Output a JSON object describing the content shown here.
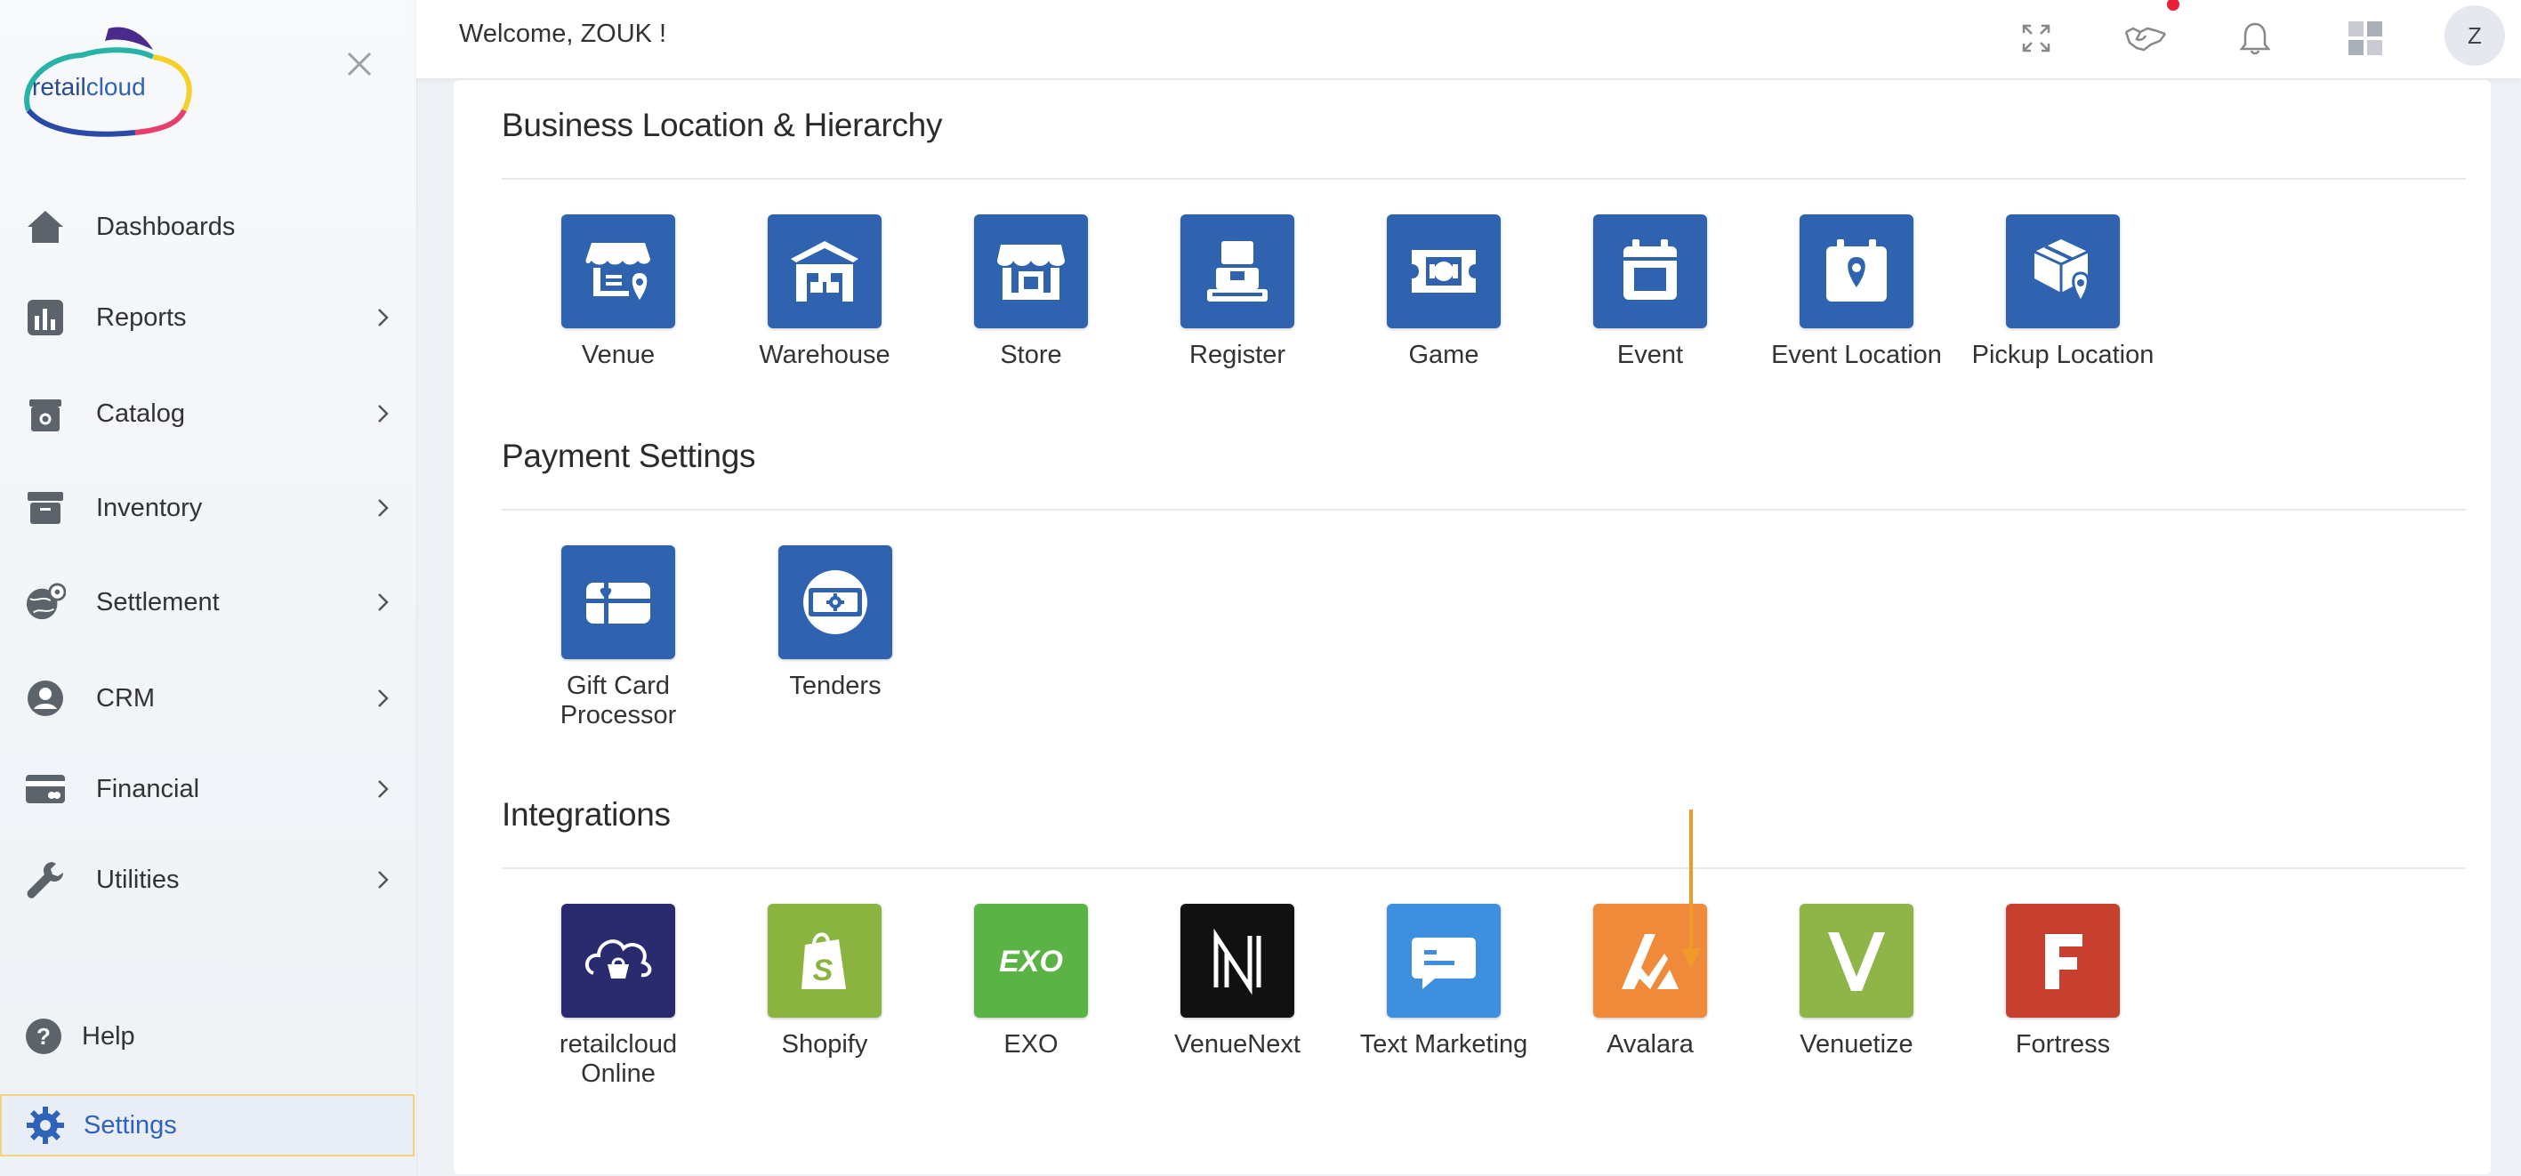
{
  "logo": {
    "text_a": "retail",
    "text_b": "cloud"
  },
  "sidebar": {
    "items": [
      {
        "label": "Dashboards",
        "icon": "home-icon"
      },
      {
        "label": "Reports",
        "icon": "bar-chart-icon"
      },
      {
        "label": "Catalog",
        "icon": "catalog-bag-icon"
      },
      {
        "label": "Inventory",
        "icon": "archive-box-icon"
      },
      {
        "label": "Settlement",
        "icon": "globe-location-icon"
      },
      {
        "label": "CRM",
        "icon": "user-circle-icon"
      },
      {
        "label": "Financial",
        "icon": "credit-card-icon"
      },
      {
        "label": "Utilities",
        "icon": "wrench-icon"
      }
    ],
    "help_label": "Help",
    "settings_label": "Settings"
  },
  "header": {
    "welcome": "Welcome, ZOUK !",
    "avatar_initial": "Z"
  },
  "sections": {
    "business": {
      "title": "Business Location & Hierarchy",
      "tiles": [
        {
          "label": "Venue",
          "icon": "venue-icon"
        },
        {
          "label": "Warehouse",
          "icon": "warehouse-icon"
        },
        {
          "label": "Store",
          "icon": "store-icon"
        },
        {
          "label": "Register",
          "icon": "register-icon"
        },
        {
          "label": "Game",
          "icon": "game-ticket-icon"
        },
        {
          "label": "Event",
          "icon": "calendar-icon"
        },
        {
          "label": "Event Location",
          "icon": "calendar-pin-icon"
        },
        {
          "label": "Pickup Location",
          "icon": "package-pin-icon"
        }
      ]
    },
    "payment": {
      "title": "Payment Settings",
      "tiles": [
        {
          "label": "Gift Card Processor",
          "icon": "gift-card-icon"
        },
        {
          "label": "Tenders",
          "icon": "cash-gear-icon"
        }
      ]
    },
    "integrations": {
      "title": "Integrations",
      "tiles": [
        {
          "label": "retailcloud Online",
          "icon": "retailcloud-online-icon",
          "color": "#2a2a6e"
        },
        {
          "label": "Shopify",
          "icon": "shopify-icon",
          "color": "#8bb33f"
        },
        {
          "label": "EXO",
          "icon": "exo-icon",
          "text": "EXO",
          "color": "#5cb345"
        },
        {
          "label": "VenueNext",
          "icon": "venuenext-icon",
          "color": "#111111"
        },
        {
          "label": "Text Marketing",
          "icon": "chat-bubble-icon",
          "color": "#3e8fe0"
        },
        {
          "label": "Avalara",
          "icon": "avalara-icon",
          "color": "#ef8a3a"
        },
        {
          "label": "Venuetize",
          "icon": "venuetize-icon",
          "color": "#8fb548"
        },
        {
          "label": "Fortress",
          "icon": "fortress-icon",
          "color": "#c7402f"
        }
      ]
    }
  },
  "colors": {
    "tile_blue": "#2f63b0",
    "accent": "#2f63b8",
    "annotation_arrow": "#ef9a2a"
  }
}
